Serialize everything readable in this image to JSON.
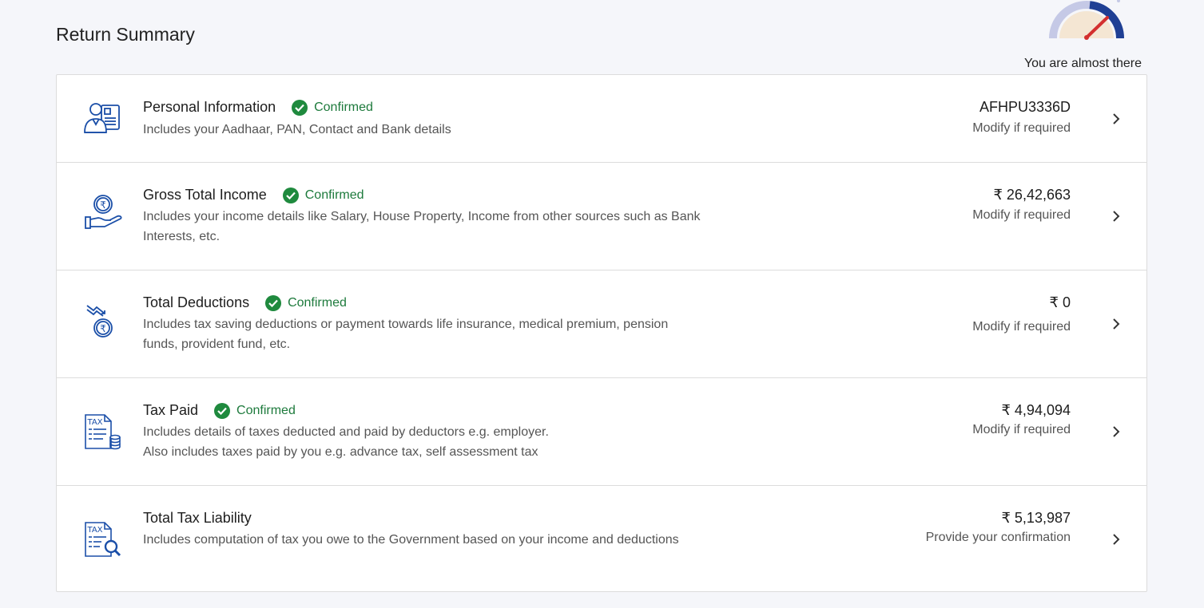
{
  "header": {
    "title": "Return Summary",
    "progress_caption": "You are almost there"
  },
  "colors": {
    "confirmed": "#1d7a3c",
    "icon_blue": "#1b4fa8",
    "gauge_needle": "#d32f2f"
  },
  "rows": [
    {
      "icon": "personal-info-icon",
      "title": "Personal Information",
      "status": "Confirmed",
      "desc": "Includes your Aadhaar, PAN, Contact and Bank details",
      "value": "AFHPU3336D",
      "action": "Modify if required"
    },
    {
      "icon": "income-hand-icon",
      "title": "Gross Total Income",
      "status": "Confirmed",
      "desc": "Includes your income details like Salary, House Property, Income from other sources such as Bank Interests, etc.",
      "value": "₹ 26,42,663",
      "action": "Modify if required"
    },
    {
      "icon": "deductions-icon",
      "title": "Total Deductions",
      "status": "Confirmed",
      "desc": "Includes tax saving deductions or payment towards life insurance, medical premium, pension funds, provident fund, etc.",
      "value": "₹ 0",
      "action": "Modify if required"
    },
    {
      "icon": "tax-paid-icon",
      "title": "Tax Paid",
      "status": "Confirmed",
      "desc_line1": "Includes details of taxes deducted and paid by deductors e.g. employer.",
      "desc_line2": "Also includes taxes paid by you e.g. advance tax, self assessment tax",
      "value": "₹ 4,94,094",
      "action": "Modify if required"
    },
    {
      "icon": "tax-liability-icon",
      "title": "Total Tax Liability",
      "desc": "Includes computation of tax you owe to the Government based on your income and deductions",
      "value": "₹ 5,13,987",
      "action": "Provide your confirmation"
    }
  ],
  "icon_text": {
    "tax_label": "TAX"
  }
}
